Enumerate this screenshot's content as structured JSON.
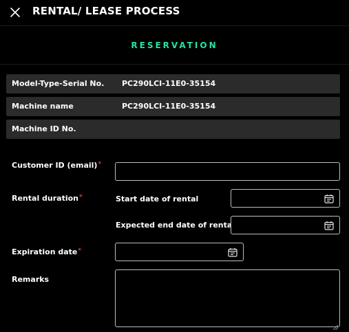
{
  "header": {
    "title": "RENTAL/ LEASE PROCESS",
    "close_icon": "close-icon"
  },
  "section": {
    "title": "RESERVATION",
    "accent_color": "#25e3a8"
  },
  "machine_info": [
    {
      "label": "Model-Type-Serial No.",
      "value": "PC290LCI-11E0-35154"
    },
    {
      "label": "Machine name",
      "value": "PC290LCI-11E0-35154"
    },
    {
      "label": "Machine ID No.",
      "value": ""
    }
  ],
  "form": {
    "required_marker": "*",
    "required_color": "#e03c3c",
    "customer_id": {
      "label": "Customer ID (email)",
      "value": ""
    },
    "rental_duration": {
      "label": "Rental duration",
      "start_label": "Start date of rental",
      "start_value": "",
      "end_label": "Expected end date of rental",
      "end_value": ""
    },
    "expiration_date": {
      "label": "Expiration date",
      "value": ""
    },
    "remarks": {
      "label": "Remarks",
      "value": ""
    },
    "calendar_icon": "calendar-icon"
  }
}
